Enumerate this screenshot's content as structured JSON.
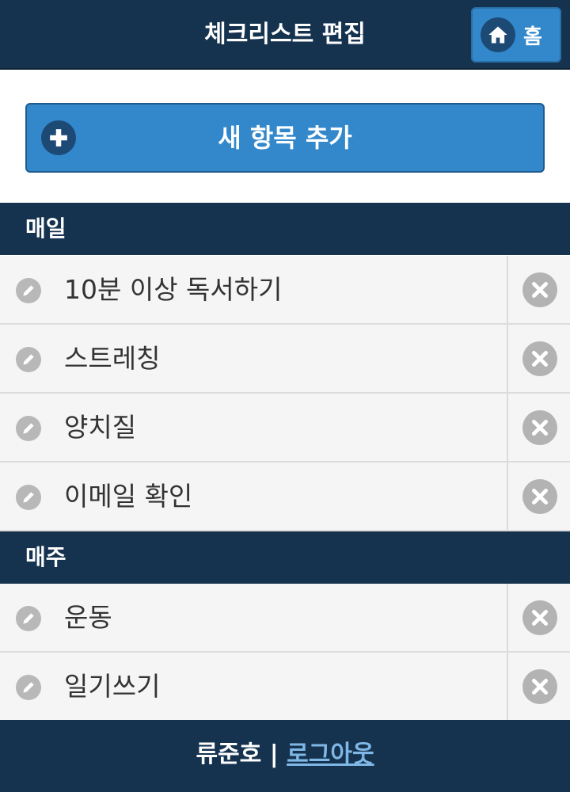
{
  "header": {
    "title": "체크리스트 편집",
    "home_label": "홈"
  },
  "add_button": {
    "label": "새 항목 추가"
  },
  "sections": [
    {
      "title": "매일",
      "items": [
        "10분 이상 독서하기",
        "스트레칭",
        "양치질",
        "이메일 확인"
      ]
    },
    {
      "title": "매주",
      "items": [
        "운동",
        "일기쓰기"
      ]
    }
  ],
  "footer": {
    "user_name": "류준호",
    "separator": "|",
    "logout_label": "로그아웃"
  },
  "icons": {
    "home": "home-icon",
    "add": "plus-circle-icon",
    "edit": "pencil-icon",
    "delete": "close-circle-icon"
  },
  "colors": {
    "header_bg": "#15334f",
    "button_bg": "#3388cc",
    "row_bg": "#f5f5f5",
    "link": "#7fb7e6"
  }
}
